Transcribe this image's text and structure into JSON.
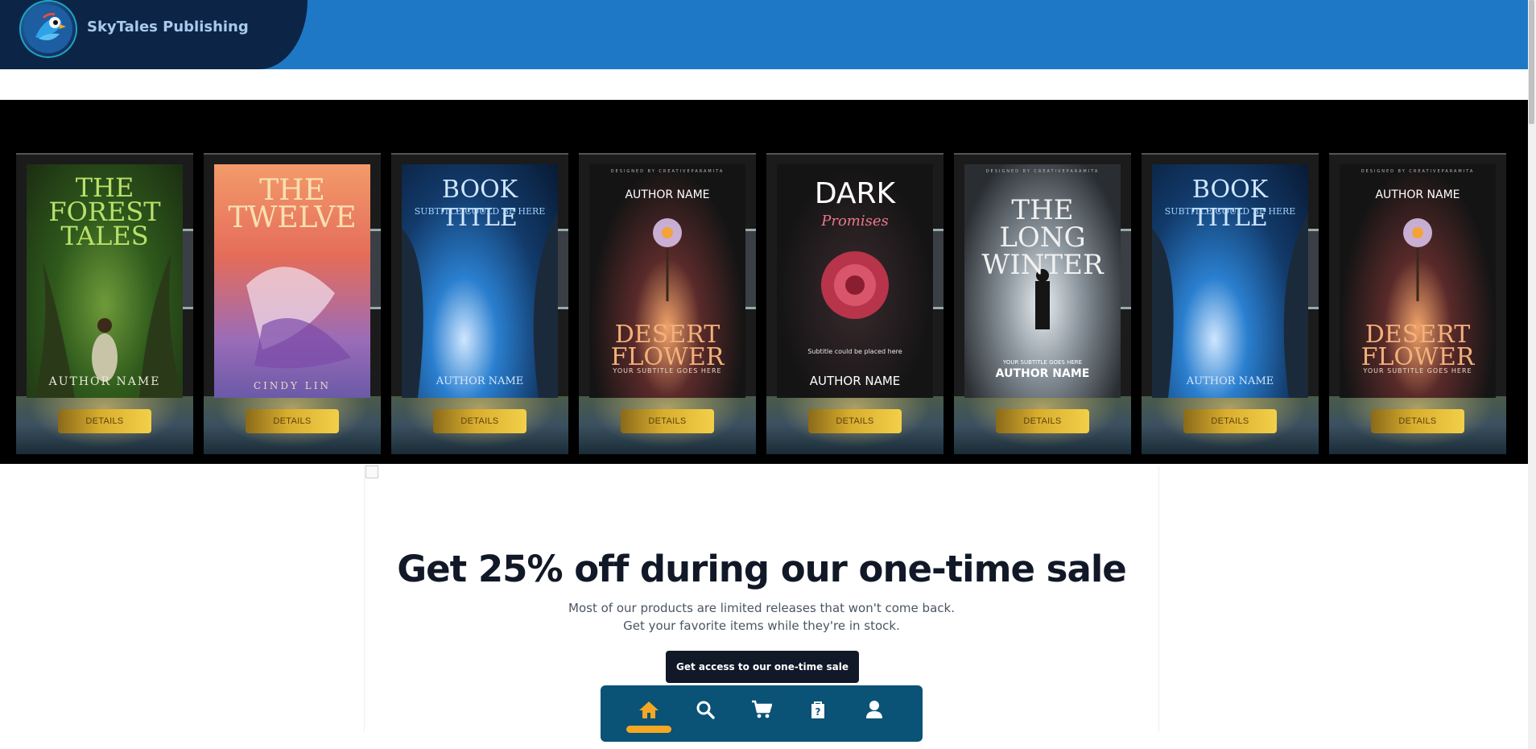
{
  "header": {
    "brand_name": "SkyTales Publishing",
    "logo_icon": "parrot-logo-icon",
    "colors": {
      "bar": "#1f78c6",
      "brand_block": "#0c2547"
    }
  },
  "carousel": {
    "details_label": "DETAILS",
    "books": [
      {
        "title": "THE FOREST TALES",
        "author": "AUTHOR NAME",
        "subtitle": "",
        "designed": ""
      },
      {
        "title": "THE TWELVE",
        "author": "CINDY LIN",
        "subtitle": "",
        "designed": ""
      },
      {
        "title": "BOOK TITLE",
        "author": "AUTHOR NAME",
        "subtitle": "SUBTITLE COULD BE HERE",
        "designed": ""
      },
      {
        "title": "DESERT FLOWER",
        "author": "AUTHOR NAME",
        "subtitle": "YOUR SUBTITLE GOES HERE",
        "designed": "DESIGNED BY CREATIVEPARAMITA"
      },
      {
        "title": "DARK",
        "title2": "Promises",
        "author": "AUTHOR NAME",
        "subtitle": "Subtitle could be placed here",
        "designed": ""
      },
      {
        "title": "THE LONG WINTER",
        "author": "AUTHOR NAME",
        "subtitle": "YOUR SUBTITLE GOES HERE",
        "designed": "DESIGNED BY CREATIVEPARAMITA"
      },
      {
        "title": "BOOK TITLE",
        "author": "AUTHOR NAME",
        "subtitle": "SUBTITLE COULD BE HERE",
        "designed": ""
      },
      {
        "title": "DESERT FLOWER",
        "author": "AUTHOR NAME",
        "subtitle": "YOUR SUBTITLE GOES HERE",
        "designed": "DESIGNED BY CREATIVEPARAMITA"
      }
    ]
  },
  "promo": {
    "title": "Get 25% off during our one-time sale",
    "line1": "Most of our products are limited releases that won't come back.",
    "line2": "Get your favorite items while they're in stock.",
    "cta_label": "Get access to our one-time sale"
  },
  "bottom_nav": {
    "items": [
      {
        "icon": "home-icon",
        "active": true
      },
      {
        "icon": "search-icon",
        "active": false
      },
      {
        "icon": "cart-icon",
        "active": false
      },
      {
        "icon": "order-bag-icon",
        "active": false
      },
      {
        "icon": "user-icon",
        "active": false
      }
    ],
    "colors": {
      "background": "#0a5276",
      "active": "#f5a623",
      "icon": "#ffffff"
    }
  }
}
